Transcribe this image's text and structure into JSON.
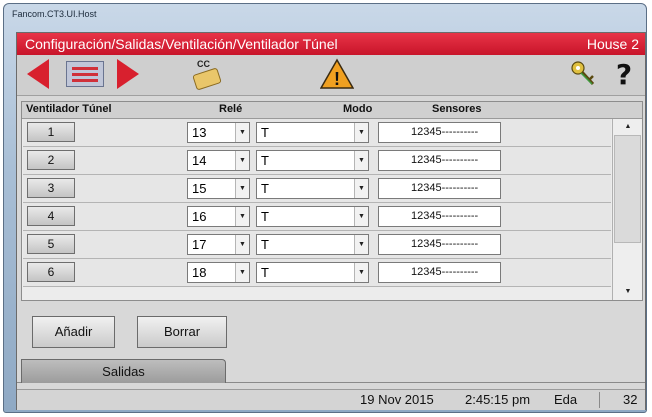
{
  "window": {
    "title": "Fancom.CT3.UI.Host"
  },
  "header": {
    "path": "Configuración/Salidas/Ventilación/Ventilador Túnel",
    "house": "House 2"
  },
  "toolbar": {
    "icons": [
      "arrow-left-icon",
      "list-icon",
      "arrow-right-icon",
      "cc-hand-icon",
      "warning-icon",
      "key-icon",
      "help-icon"
    ],
    "cc_label": "CC",
    "warning_glyph": "!",
    "help_glyph": "?"
  },
  "table": {
    "headers": {
      "fan": "Ventilador Túnel",
      "relay": "Relé",
      "mode": "Modo",
      "sensors": "Sensores"
    },
    "rows": [
      {
        "num": "1",
        "relay": "13",
        "mode": "T",
        "sensors": "12345----------"
      },
      {
        "num": "2",
        "relay": "14",
        "mode": "T",
        "sensors": "12345----------"
      },
      {
        "num": "3",
        "relay": "15",
        "mode": "T",
        "sensors": "12345----------"
      },
      {
        "num": "4",
        "relay": "16",
        "mode": "T",
        "sensors": "12345----------"
      },
      {
        "num": "5",
        "relay": "17",
        "mode": "T",
        "sensors": "12345----------"
      },
      {
        "num": "6",
        "relay": "18",
        "mode": "T",
        "sensors": "12345----------"
      }
    ],
    "combo_arrow": "▼",
    "scroll_up": "▲",
    "scroll_down": "▼"
  },
  "actions": {
    "add": "Añadir",
    "delete": "Borrar"
  },
  "tabs": {
    "active": "Salidas"
  },
  "status": {
    "date": "19 Nov 2015",
    "time": "2:45:15 pm",
    "unit": "Eda",
    "number": "32"
  },
  "colors": {
    "header_red": "#d81c30",
    "arrow_red": "#d8202e",
    "warning_orange": "#f0a020"
  }
}
